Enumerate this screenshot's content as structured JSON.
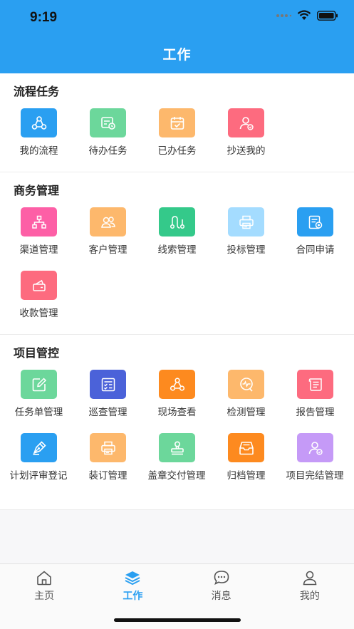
{
  "status": {
    "time": "9:19"
  },
  "header": {
    "title": "工作"
  },
  "sections": [
    {
      "title": "流程任务",
      "items": [
        {
          "label": "我的流程",
          "icon": "flow-icon",
          "color": "#2a9ff1"
        },
        {
          "label": "待办任务",
          "icon": "pending-task-icon",
          "color": "#6cd79b"
        },
        {
          "label": "已办任务",
          "icon": "done-task-icon",
          "color": "#fdb86c"
        },
        {
          "label": "抄送我的",
          "icon": "cc-me-icon",
          "color": "#fd6b7f"
        }
      ]
    },
    {
      "title": "商务管理",
      "items": [
        {
          "label": "渠道管理",
          "icon": "channel-icon",
          "color": "#fd5fa6"
        },
        {
          "label": "客户管理",
          "icon": "customer-icon",
          "color": "#fdb86c"
        },
        {
          "label": "线索管理",
          "icon": "clue-icon",
          "color": "#34c98a"
        },
        {
          "label": "投标管理",
          "icon": "bid-icon",
          "color": "#a4dcff"
        },
        {
          "label": "合同申请",
          "icon": "contract-icon",
          "color": "#2a9ff1"
        },
        {
          "label": "收款管理",
          "icon": "payment-icon",
          "color": "#fd6b7f"
        }
      ]
    },
    {
      "title": "项目管控",
      "items": [
        {
          "label": "任务单管理",
          "icon": "task-order-icon",
          "color": "#6cd79b"
        },
        {
          "label": "巡查管理",
          "icon": "patrol-icon",
          "color": "#4b62d9"
        },
        {
          "label": "现场查看",
          "icon": "site-view-icon",
          "color": "#fd8a1f"
        },
        {
          "label": "检测管理",
          "icon": "detection-icon",
          "color": "#fdb86c"
        },
        {
          "label": "报告管理",
          "icon": "report-icon",
          "color": "#fd6b7f"
        },
        {
          "label": "计划评审登记",
          "icon": "plan-review-icon",
          "color": "#2a9ff1"
        },
        {
          "label": "装订管理",
          "icon": "binding-icon",
          "color": "#fdb86c"
        },
        {
          "label": "盖章交付管理",
          "icon": "stamp-icon",
          "color": "#6cd79b"
        },
        {
          "label": "归档管理",
          "icon": "archive-icon",
          "color": "#fd8a1f"
        },
        {
          "label": "项目完结管理",
          "icon": "project-complete-icon",
          "color": "#c59af7"
        }
      ]
    }
  ],
  "tabbar": {
    "tabs": [
      {
        "label": "主页",
        "icon": "home-icon"
      },
      {
        "label": "工作",
        "icon": "layers-icon"
      },
      {
        "label": "消息",
        "icon": "chat-icon"
      },
      {
        "label": "我的",
        "icon": "user-icon"
      }
    ],
    "active_color": "#2a9ff1"
  }
}
